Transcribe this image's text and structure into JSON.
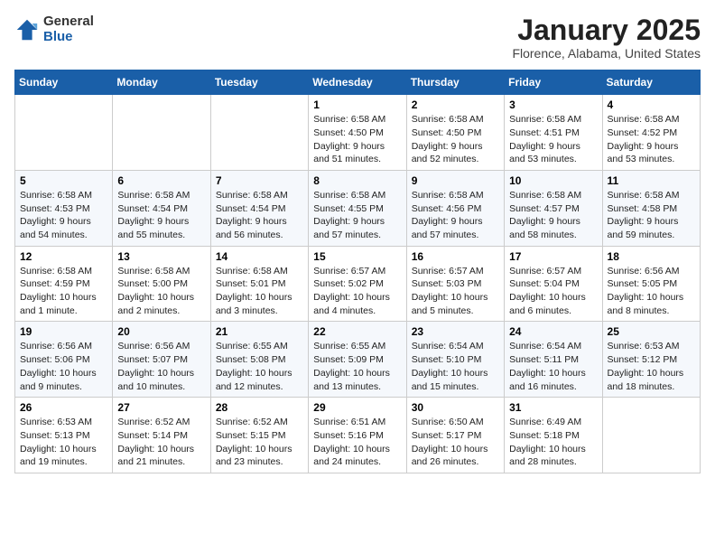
{
  "header": {
    "logo_general": "General",
    "logo_blue": "Blue",
    "title": "January 2025",
    "location": "Florence, Alabama, United States"
  },
  "calendar": {
    "days_of_week": [
      "Sunday",
      "Monday",
      "Tuesday",
      "Wednesday",
      "Thursday",
      "Friday",
      "Saturday"
    ],
    "weeks": [
      [
        {
          "day": "",
          "info": ""
        },
        {
          "day": "",
          "info": ""
        },
        {
          "day": "",
          "info": ""
        },
        {
          "day": "1",
          "info": "Sunrise: 6:58 AM\nSunset: 4:50 PM\nDaylight: 9 hours\nand 51 minutes."
        },
        {
          "day": "2",
          "info": "Sunrise: 6:58 AM\nSunset: 4:50 PM\nDaylight: 9 hours\nand 52 minutes."
        },
        {
          "day": "3",
          "info": "Sunrise: 6:58 AM\nSunset: 4:51 PM\nDaylight: 9 hours\nand 53 minutes."
        },
        {
          "day": "4",
          "info": "Sunrise: 6:58 AM\nSunset: 4:52 PM\nDaylight: 9 hours\nand 53 minutes."
        }
      ],
      [
        {
          "day": "5",
          "info": "Sunrise: 6:58 AM\nSunset: 4:53 PM\nDaylight: 9 hours\nand 54 minutes."
        },
        {
          "day": "6",
          "info": "Sunrise: 6:58 AM\nSunset: 4:54 PM\nDaylight: 9 hours\nand 55 minutes."
        },
        {
          "day": "7",
          "info": "Sunrise: 6:58 AM\nSunset: 4:54 PM\nDaylight: 9 hours\nand 56 minutes."
        },
        {
          "day": "8",
          "info": "Sunrise: 6:58 AM\nSunset: 4:55 PM\nDaylight: 9 hours\nand 57 minutes."
        },
        {
          "day": "9",
          "info": "Sunrise: 6:58 AM\nSunset: 4:56 PM\nDaylight: 9 hours\nand 57 minutes."
        },
        {
          "day": "10",
          "info": "Sunrise: 6:58 AM\nSunset: 4:57 PM\nDaylight: 9 hours\nand 58 minutes."
        },
        {
          "day": "11",
          "info": "Sunrise: 6:58 AM\nSunset: 4:58 PM\nDaylight: 9 hours\nand 59 minutes."
        }
      ],
      [
        {
          "day": "12",
          "info": "Sunrise: 6:58 AM\nSunset: 4:59 PM\nDaylight: 10 hours\nand 1 minute."
        },
        {
          "day": "13",
          "info": "Sunrise: 6:58 AM\nSunset: 5:00 PM\nDaylight: 10 hours\nand 2 minutes."
        },
        {
          "day": "14",
          "info": "Sunrise: 6:58 AM\nSunset: 5:01 PM\nDaylight: 10 hours\nand 3 minutes."
        },
        {
          "day": "15",
          "info": "Sunrise: 6:57 AM\nSunset: 5:02 PM\nDaylight: 10 hours\nand 4 minutes."
        },
        {
          "day": "16",
          "info": "Sunrise: 6:57 AM\nSunset: 5:03 PM\nDaylight: 10 hours\nand 5 minutes."
        },
        {
          "day": "17",
          "info": "Sunrise: 6:57 AM\nSunset: 5:04 PM\nDaylight: 10 hours\nand 6 minutes."
        },
        {
          "day": "18",
          "info": "Sunrise: 6:56 AM\nSunset: 5:05 PM\nDaylight: 10 hours\nand 8 minutes."
        }
      ],
      [
        {
          "day": "19",
          "info": "Sunrise: 6:56 AM\nSunset: 5:06 PM\nDaylight: 10 hours\nand 9 minutes."
        },
        {
          "day": "20",
          "info": "Sunrise: 6:56 AM\nSunset: 5:07 PM\nDaylight: 10 hours\nand 10 minutes."
        },
        {
          "day": "21",
          "info": "Sunrise: 6:55 AM\nSunset: 5:08 PM\nDaylight: 10 hours\nand 12 minutes."
        },
        {
          "day": "22",
          "info": "Sunrise: 6:55 AM\nSunset: 5:09 PM\nDaylight: 10 hours\nand 13 minutes."
        },
        {
          "day": "23",
          "info": "Sunrise: 6:54 AM\nSunset: 5:10 PM\nDaylight: 10 hours\nand 15 minutes."
        },
        {
          "day": "24",
          "info": "Sunrise: 6:54 AM\nSunset: 5:11 PM\nDaylight: 10 hours\nand 16 minutes."
        },
        {
          "day": "25",
          "info": "Sunrise: 6:53 AM\nSunset: 5:12 PM\nDaylight: 10 hours\nand 18 minutes."
        }
      ],
      [
        {
          "day": "26",
          "info": "Sunrise: 6:53 AM\nSunset: 5:13 PM\nDaylight: 10 hours\nand 19 minutes."
        },
        {
          "day": "27",
          "info": "Sunrise: 6:52 AM\nSunset: 5:14 PM\nDaylight: 10 hours\nand 21 minutes."
        },
        {
          "day": "28",
          "info": "Sunrise: 6:52 AM\nSunset: 5:15 PM\nDaylight: 10 hours\nand 23 minutes."
        },
        {
          "day": "29",
          "info": "Sunrise: 6:51 AM\nSunset: 5:16 PM\nDaylight: 10 hours\nand 24 minutes."
        },
        {
          "day": "30",
          "info": "Sunrise: 6:50 AM\nSunset: 5:17 PM\nDaylight: 10 hours\nand 26 minutes."
        },
        {
          "day": "31",
          "info": "Sunrise: 6:49 AM\nSunset: 5:18 PM\nDaylight: 10 hours\nand 28 minutes."
        },
        {
          "day": "",
          "info": ""
        }
      ]
    ]
  }
}
